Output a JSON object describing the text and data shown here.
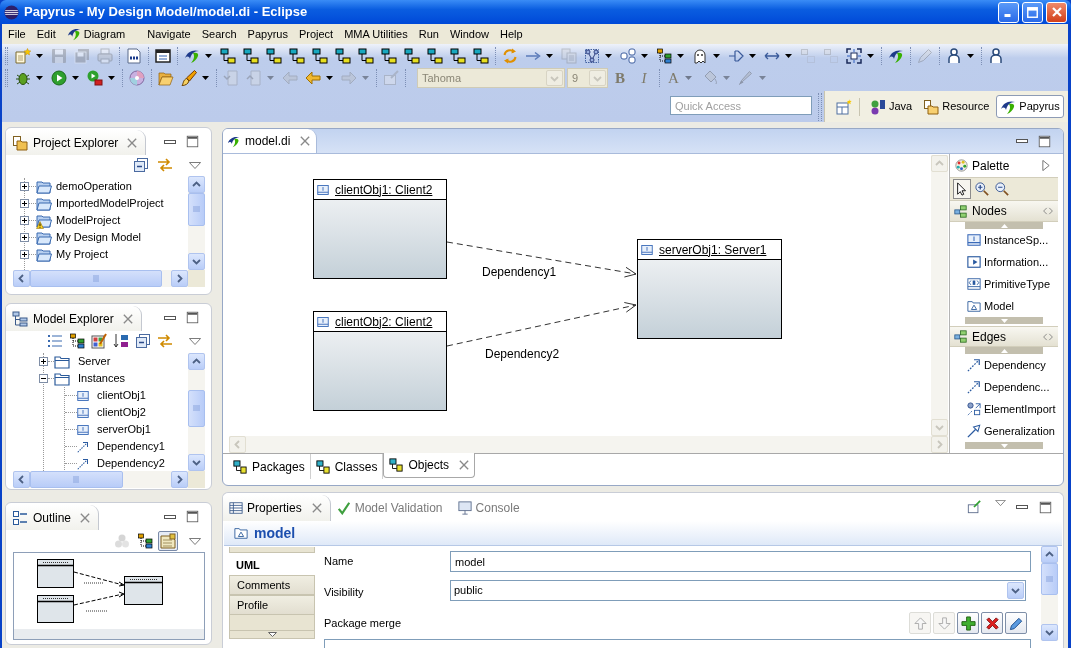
{
  "window": {
    "title": "Papyrus - My Design Model/model.di - Eclipse"
  },
  "menu_bar": [
    {
      "label": "File",
      "icon": false
    },
    {
      "label": "Edit",
      "icon": false
    },
    {
      "label": "Diagram",
      "icon": true
    },
    {
      "label": "Navigate",
      "icon": false
    },
    {
      "label": "Search",
      "icon": false
    },
    {
      "label": "Papyrus",
      "icon": false
    },
    {
      "label": "Project",
      "icon": false
    },
    {
      "label": "MMA Utilities",
      "icon": false
    },
    {
      "label": "Run",
      "icon": false
    },
    {
      "label": "Window",
      "icon": false
    },
    {
      "label": "Help",
      "icon": false
    }
  ],
  "toolbar": {
    "rows": [
      [
        {
          "kind": "newfile",
          "menu": true,
          "disabled": false
        },
        {
          "kind": "save",
          "menu": false,
          "disabled": true
        },
        {
          "kind": "saveall",
          "menu": false,
          "disabled": true
        },
        {
          "kind": "print",
          "menu": false,
          "disabled": true
        },
        {
          "kind": "sep"
        },
        {
          "kind": "binary",
          "menu": false,
          "disabled": false
        },
        {
          "kind": "sep"
        },
        {
          "kind": "window",
          "menu": false,
          "disabled": false
        },
        {
          "kind": "sep"
        },
        {
          "kind": "swoosh",
          "menu": true,
          "disabled": false
        },
        {
          "kind": "diagram",
          "menu": false,
          "disabled": false
        },
        {
          "kind": "diagram",
          "menu": false,
          "disabled": false
        },
        {
          "kind": "diagram",
          "menu": false,
          "disabled": false
        },
        {
          "kind": "diagram",
          "menu": false,
          "disabled": false
        },
        {
          "kind": "diagram",
          "menu": false,
          "disabled": false
        },
        {
          "kind": "diagram",
          "menu": false,
          "disabled": false
        },
        {
          "kind": "diagram",
          "menu": false,
          "disabled": false
        },
        {
          "kind": "diagram",
          "menu": false,
          "disabled": false
        },
        {
          "kind": "diagram",
          "menu": false,
          "disabled": false
        },
        {
          "kind": "diagram",
          "menu": false,
          "disabled": false
        },
        {
          "kind": "diagram",
          "menu": false,
          "disabled": false
        },
        {
          "kind": "diagram",
          "menu": false,
          "disabled": false
        },
        {
          "kind": "sep"
        },
        {
          "kind": "sync",
          "menu": false,
          "disabled": false
        },
        {
          "kind": "arrow",
          "menu": true,
          "disabled": false
        },
        {
          "kind": "copy",
          "menu": false,
          "disabled": true
        },
        {
          "kind": "layout",
          "menu": true,
          "disabled": false
        },
        {
          "kind": "shapes",
          "menu": true,
          "disabled": false
        },
        {
          "kind": "tree",
          "menu": true,
          "disabled": false
        },
        {
          "kind": "ghost",
          "menu": true,
          "disabled": false
        },
        {
          "kind": "routing",
          "menu": true,
          "disabled": false
        },
        {
          "kind": "resize",
          "menu": true,
          "disabled": false
        },
        {
          "kind": "size",
          "menu": false,
          "disabled": true
        },
        {
          "kind": "size",
          "menu": false,
          "disabled": true
        },
        {
          "kind": "select",
          "menu": true,
          "disabled": false
        },
        {
          "kind": "sep"
        },
        {
          "kind": "swoosh",
          "menu": false,
          "disabled": false
        },
        {
          "kind": "sep"
        },
        {
          "kind": "pencil",
          "menu": false,
          "disabled": true
        },
        {
          "kind": "sep"
        },
        {
          "kind": "person",
          "menu": true,
          "disabled": false
        },
        {
          "kind": "sep"
        },
        {
          "kind": "person",
          "menu": false,
          "disabled": false
        }
      ],
      [
        {
          "kind": "bug",
          "menu": true,
          "disabled": false
        },
        {
          "kind": "run",
          "menu": true,
          "disabled": false
        },
        {
          "kind": "runext",
          "menu": true,
          "disabled": false
        },
        {
          "kind": "sep"
        },
        {
          "kind": "disc",
          "menu": false,
          "disabled": false
        },
        {
          "kind": "sep"
        },
        {
          "kind": "folder",
          "menu": false,
          "disabled": false
        },
        {
          "kind": "brush",
          "menu": true,
          "disabled": false
        },
        {
          "kind": "sep"
        },
        {
          "kind": "docdown",
          "menu": false,
          "disabled": true
        },
        {
          "kind": "docup",
          "menu": true,
          "disabled": true
        },
        {
          "kind": "back",
          "menu": false,
          "disabled": true
        },
        {
          "kind": "back",
          "menu": true,
          "disabled": false
        },
        {
          "kind": "forward",
          "menu": true,
          "disabled": true
        },
        {
          "kind": "sep"
        },
        {
          "kind": "pin",
          "menu": false,
          "disabled": true
        },
        {
          "kind": "sep"
        },
        {
          "kind": "combo",
          "value": "Tahoma",
          "disabled": true
        },
        {
          "kind": "combo",
          "value": "9",
          "disabled": true
        },
        {
          "kind": "bold",
          "label": "B",
          "menu": false,
          "disabled": true
        },
        {
          "kind": "italic",
          "label": "I",
          "menu": false,
          "disabled": true
        },
        {
          "kind": "sep"
        },
        {
          "kind": "fontcolor",
          "label": "A",
          "menu": true,
          "disabled": true
        },
        {
          "kind": "bucket",
          "menu": true,
          "disabled": true
        },
        {
          "kind": "pen",
          "menu": true,
          "disabled": true
        }
      ]
    ]
  },
  "quick_access": {
    "placeholder": "Quick Access"
  },
  "perspectives": [
    {
      "label": "Java",
      "kind": "java",
      "selected": false
    },
    {
      "label": "Resource",
      "kind": "resource",
      "selected": false
    },
    {
      "label": "Papyrus",
      "kind": "papyrus",
      "selected": true
    }
  ],
  "project_explorer": {
    "title": "Project Explorer",
    "items": [
      {
        "label": "demoOperation",
        "expanded": false,
        "warning": false
      },
      {
        "label": "ImportedModelProject",
        "expanded": false,
        "warning": false
      },
      {
        "label": "ModelProject",
        "expanded": false,
        "warning": true
      },
      {
        "label": "My Design Model",
        "expanded": false,
        "warning": false
      },
      {
        "label": "My Project",
        "expanded": false,
        "warning": false
      }
    ]
  },
  "model_explorer": {
    "title": "Model Explorer",
    "items": [
      {
        "label": "Server",
        "kind": "folder",
        "expanded": false
      },
      {
        "label": "Instances",
        "kind": "folder",
        "expanded": true,
        "children": [
          {
            "label": "clientObj1",
            "kind": "instance"
          },
          {
            "label": "clientObj2",
            "kind": "instance"
          },
          {
            "label": "serverObj1",
            "kind": "instance"
          },
          {
            "label": "Dependency1",
            "kind": "dependency"
          },
          {
            "label": "Dependency2",
            "kind": "dependency"
          }
        ]
      }
    ]
  },
  "outline": {
    "title": "Outline",
    "tools": [
      {
        "kind": "circles",
        "disabled": true,
        "selected": false
      },
      {
        "kind": "tree",
        "disabled": false,
        "selected": false
      },
      {
        "kind": "overview",
        "disabled": false,
        "selected": true
      }
    ]
  },
  "editor": {
    "tabs": [
      {
        "label": "model.di",
        "selected": true
      }
    ],
    "diagram": {
      "nodes": [
        {
          "label": "clientObj1: Client2"
        },
        {
          "label": "clientObj2: Client2"
        },
        {
          "label": "serverObj1: Server1"
        }
      ],
      "edges": [
        {
          "label": "Dependency1"
        },
        {
          "label": "Dependency2"
        }
      ]
    },
    "page_tabs": [
      {
        "label": "Packages",
        "selected": false
      },
      {
        "label": "Classes",
        "selected": false
      },
      {
        "label": "Objects",
        "selected": true
      }
    ]
  },
  "palette": {
    "title": "Palette",
    "tools": [
      {
        "kind": "select",
        "selected": true
      },
      {
        "kind": "zoomin",
        "selected": false
      },
      {
        "kind": "zoomout",
        "selected": false
      }
    ],
    "drawers": [
      {
        "label": "Nodes",
        "items": [
          {
            "label": "InstanceSp...",
            "kind": "instance"
          },
          {
            "label": "Information...",
            "kind": "information"
          },
          {
            "label": "PrimitiveType",
            "kind": "primitive"
          },
          {
            "label": "Model",
            "kind": "model"
          }
        ]
      },
      {
        "label": "Edges",
        "items": [
          {
            "label": "Dependency",
            "kind": "dependency"
          },
          {
            "label": "Dependenc...",
            "kind": "dependency"
          },
          {
            "label": "ElementImport",
            "kind": "import"
          },
          {
            "label": "Generalization",
            "kind": "generalization"
          }
        ]
      }
    ]
  },
  "properties": {
    "tabs": [
      {
        "label": "Properties",
        "kind": "table",
        "selected": true
      },
      {
        "label": "Model Validation",
        "kind": "check",
        "selected": false
      },
      {
        "label": "Console",
        "kind": "console",
        "selected": false
      }
    ],
    "title": "model",
    "sections": [
      {
        "label": "UML",
        "selected": true
      },
      {
        "label": "Comments",
        "selected": false
      },
      {
        "label": "Profile",
        "selected": false
      }
    ],
    "fields": [
      {
        "kind": "text",
        "label": "Name",
        "value": "model"
      },
      {
        "kind": "combo",
        "label": "Visibility",
        "value": "public"
      },
      {
        "kind": "list",
        "label": "Package merge",
        "buttons": [
          {
            "kind": "up",
            "disabled": true
          },
          {
            "kind": "down",
            "disabled": true
          },
          {
            "kind": "add",
            "disabled": false
          },
          {
            "kind": "delete",
            "disabled": false
          },
          {
            "kind": "edit",
            "disabled": false
          }
        ]
      }
    ]
  }
}
